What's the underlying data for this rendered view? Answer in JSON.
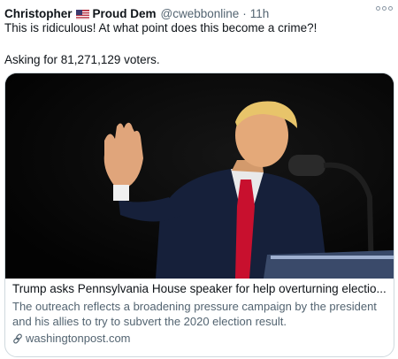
{
  "tweet": {
    "author_name": "Christopher",
    "author_name_suffix": "Proud Dem",
    "handle": "@cwebbonline",
    "separator": "·",
    "time": "11h",
    "line1": "This is ridiculous! At what point does this become a crime?!",
    "line2": "Asking for 81,271,129 voters."
  },
  "card": {
    "title": "Trump asks Pennsylvania House speaker for help overturning electio...",
    "description": "The outreach reflects a broadening pressure campaign by the president and his allies to try to subvert the 2020 election result.",
    "domain": "washingtonpost.com"
  },
  "icons": {
    "flag": "us-flag-icon",
    "more": "more-options-icon",
    "link": "link-icon"
  },
  "colors": {
    "text_primary": "#0f1419",
    "text_secondary": "#536471",
    "border": "#cfd9de",
    "tie_red": "#c8102e"
  }
}
